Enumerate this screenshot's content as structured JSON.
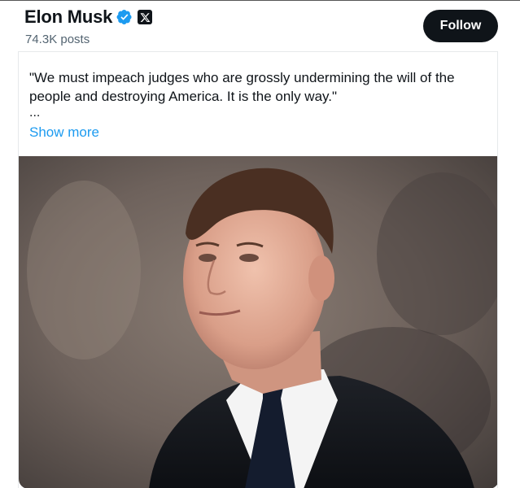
{
  "header": {
    "display_name": "Elon Musk",
    "post_count": "74.3K posts",
    "verified_icon": "verified-badge-icon",
    "affiliate_icon": "x-logo-icon",
    "follow_label": "Follow"
  },
  "tweet": {
    "text": "\"We must impeach judges who are grossly undermining the will of the people and destroying America. It is the only way.\"",
    "ellipsis": "...",
    "show_more": "Show more"
  },
  "media": {
    "alt_subject": "photo"
  },
  "colors": {
    "text": "#0f1419",
    "secondary": "#536471",
    "link": "#1d9bf0",
    "verified": "#1d9bf0",
    "button_bg": "#0f1419"
  }
}
